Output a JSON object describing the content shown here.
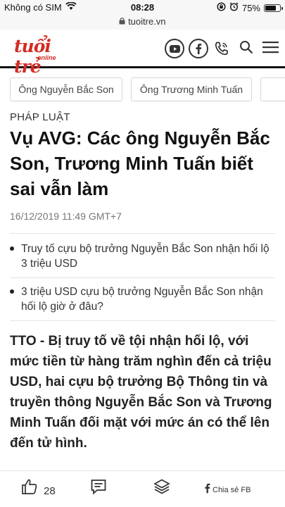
{
  "status": {
    "carrier": "Không có SIM",
    "time": "08:28",
    "battery": "75%",
    "battery_level": 0.75
  },
  "browser": {
    "url": "tuoitre.vn"
  },
  "header": {
    "logo_main": "tuổi trẻ",
    "logo_sub": "online",
    "brand_color": "#d42b25"
  },
  "tags": [
    "Ông Nguyễn Bắc Son",
    "Ông Trương Minh Tuấn"
  ],
  "article": {
    "category": "PHÁP LUẬT",
    "title": "Vụ AVG: Các ông Nguyễn Bắc Son, Trương Minh Tuấn biết sai vẫn làm",
    "date": "16/12/2019 11:49 GMT+7",
    "related": [
      "Truy tố cựu bộ trưởng Nguyễn Bắc Son nhận hối lộ 3 triệu USD",
      "3 triệu USD cựu bộ trưởng Nguyễn Bắc Son nhận hối lộ giờ ở đâu?"
    ],
    "lead": "TTO - Bị truy tố về tội nhận hối lộ, với mức tiền từ hàng trăm nghìn đến cả triệu USD, hai cựu bộ trưởng Bộ Thông tin và truyền thông Nguyễn Bắc Son và Trương Minh Tuấn đối mặt với mức án có thể lên đến tử hình."
  },
  "bottom_bar": {
    "likes": "28",
    "share_label": "Chia sẻ FB"
  }
}
